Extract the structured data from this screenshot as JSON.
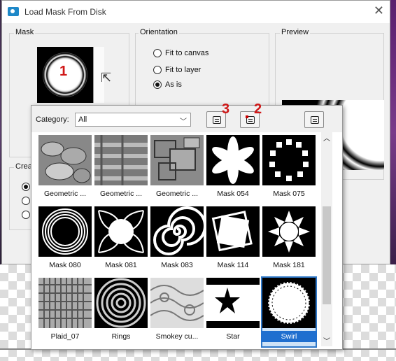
{
  "window": {
    "title": "Load Mask From Disk"
  },
  "mask": {
    "group_label": "Mask"
  },
  "orientation": {
    "group_label": "Orientation",
    "options": [
      {
        "label": "Fit to canvas",
        "selected": false
      },
      {
        "label": "Fit to layer",
        "selected": false
      },
      {
        "label": "As is",
        "selected": true
      }
    ]
  },
  "preview": {
    "group_label": "Preview"
  },
  "create": {
    "group_label": "Crea"
  },
  "annotations": {
    "one": "1",
    "two": "2",
    "three": "3"
  },
  "popup": {
    "category_label": "Category:",
    "category_value": "All",
    "tiles": [
      {
        "label": "Geometric ...",
        "icon": "geometric-1"
      },
      {
        "label": "Geometric ...",
        "icon": "geometric-2"
      },
      {
        "label": "Geometric ...",
        "icon": "geometric-3"
      },
      {
        "label": "Mask 054",
        "icon": "flower"
      },
      {
        "label": "Mask 075",
        "icon": "dot-ring"
      },
      {
        "label": "Mask 080",
        "icon": "concentric-circle"
      },
      {
        "label": "Mask 081",
        "icon": "petals"
      },
      {
        "label": "Mask 083",
        "icon": "spiral"
      },
      {
        "label": "Mask 114",
        "icon": "tilted-squares"
      },
      {
        "label": "Mask 181",
        "icon": "sun"
      },
      {
        "label": "Plaid_07",
        "icon": "plaid"
      },
      {
        "label": "Rings",
        "icon": "rings"
      },
      {
        "label": "Smokey cu...",
        "icon": "smoke"
      },
      {
        "label": "Star",
        "icon": "star"
      },
      {
        "label": "Swirl",
        "icon": "swirl",
        "selected": true
      }
    ]
  },
  "colors": {
    "selection": "#1f6fcf",
    "annotation": "#d01818"
  }
}
